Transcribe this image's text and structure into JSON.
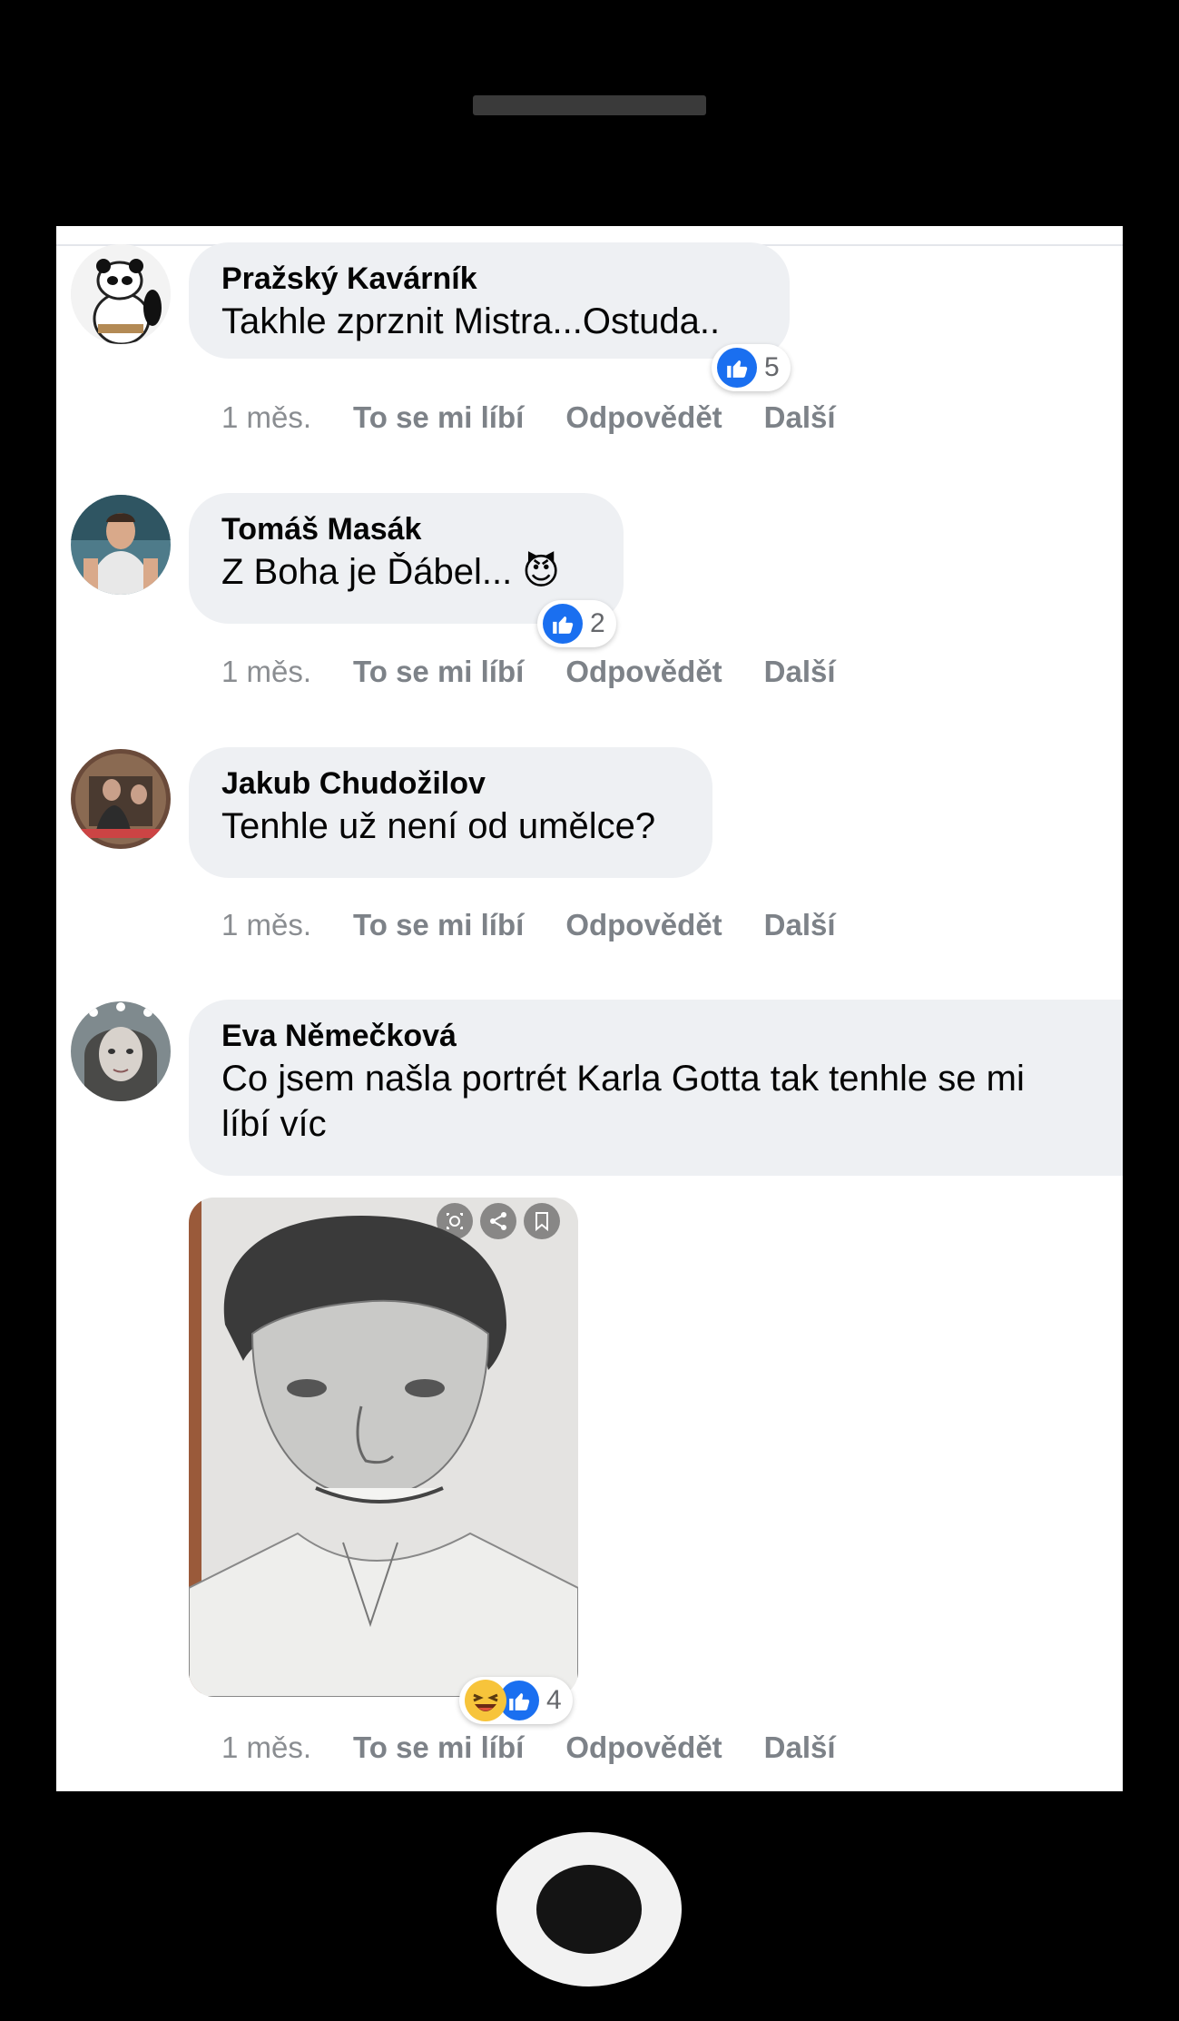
{
  "comments": [
    {
      "author": "Pražský Kavárník",
      "text": "Takhle zprznit Mistra...Ostuda..",
      "reactions": {
        "count": "5",
        "types": [
          "like-icon"
        ]
      },
      "actions": {
        "time": "1 měs.",
        "like": "To se mi líbí",
        "reply": "Odpovědět",
        "more": "Další"
      }
    },
    {
      "author": "Tomáš Masák",
      "text": "Z Boha je Ďábel... 😈",
      "reactions": {
        "count": "2",
        "types": [
          "like-icon"
        ]
      },
      "actions": {
        "time": "1 měs.",
        "like": "To se mi líbí",
        "reply": "Odpovědět",
        "more": "Další"
      }
    },
    {
      "author": "Jakub Chudožilov",
      "text": "Tenhle už není od umělce?",
      "actions": {
        "time": "1 měs.",
        "like": "To se mi líbí",
        "reply": "Odpovědět",
        "more": "Další"
      }
    },
    {
      "author": "Eva Němečková",
      "text_line1": "Co jsem našla portrét Karla Gotta tak tenhle se mi",
      "text_line2": "líbí víc",
      "reactions": {
        "count": "4",
        "types": [
          "haha-icon",
          "like-icon"
        ]
      },
      "actions": {
        "time": "1 měs.",
        "like": "To se mi líbí",
        "reply": "Odpovědět",
        "more": "Další"
      }
    }
  ],
  "colors": {
    "like_blue": "#1a6ff0",
    "bubble_bg": "#eef0f3",
    "meta_gray": "#8a8d91"
  }
}
